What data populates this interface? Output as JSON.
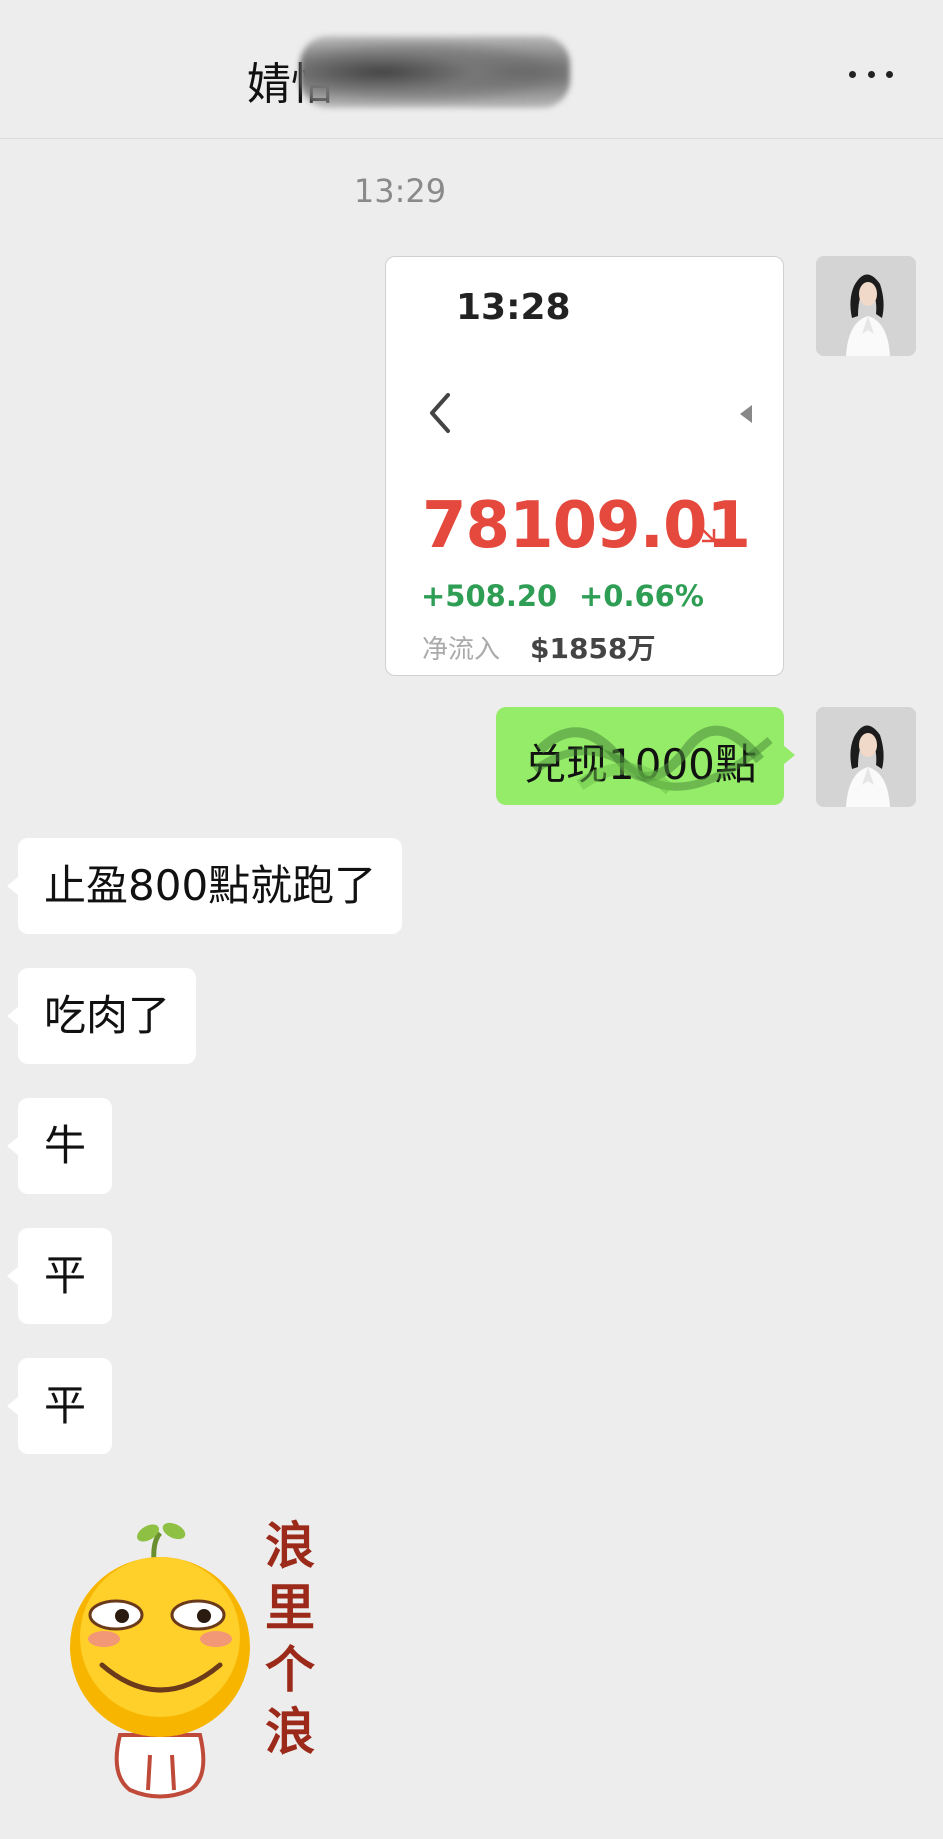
{
  "header": {
    "title": "婧怡"
  },
  "chat": {
    "timestamp": "13:29",
    "card": {
      "time": "13:28",
      "price": "78109.01",
      "change": "+508.20",
      "change_pct": "+0.66%",
      "net_inflow_label": "净流入",
      "net_inflow_value": "$1858万"
    },
    "sent_text": "兑现1000點",
    "received": [
      "止盈800點就跑了",
      "吃肉了",
      "牛",
      "平",
      "平"
    ],
    "sticker_text": "浪里个浪"
  },
  "colors": {
    "bubble_green": "#95ec69",
    "price_red": "#e5483c",
    "change_green": "#2f9e55",
    "background": "#ededed"
  }
}
